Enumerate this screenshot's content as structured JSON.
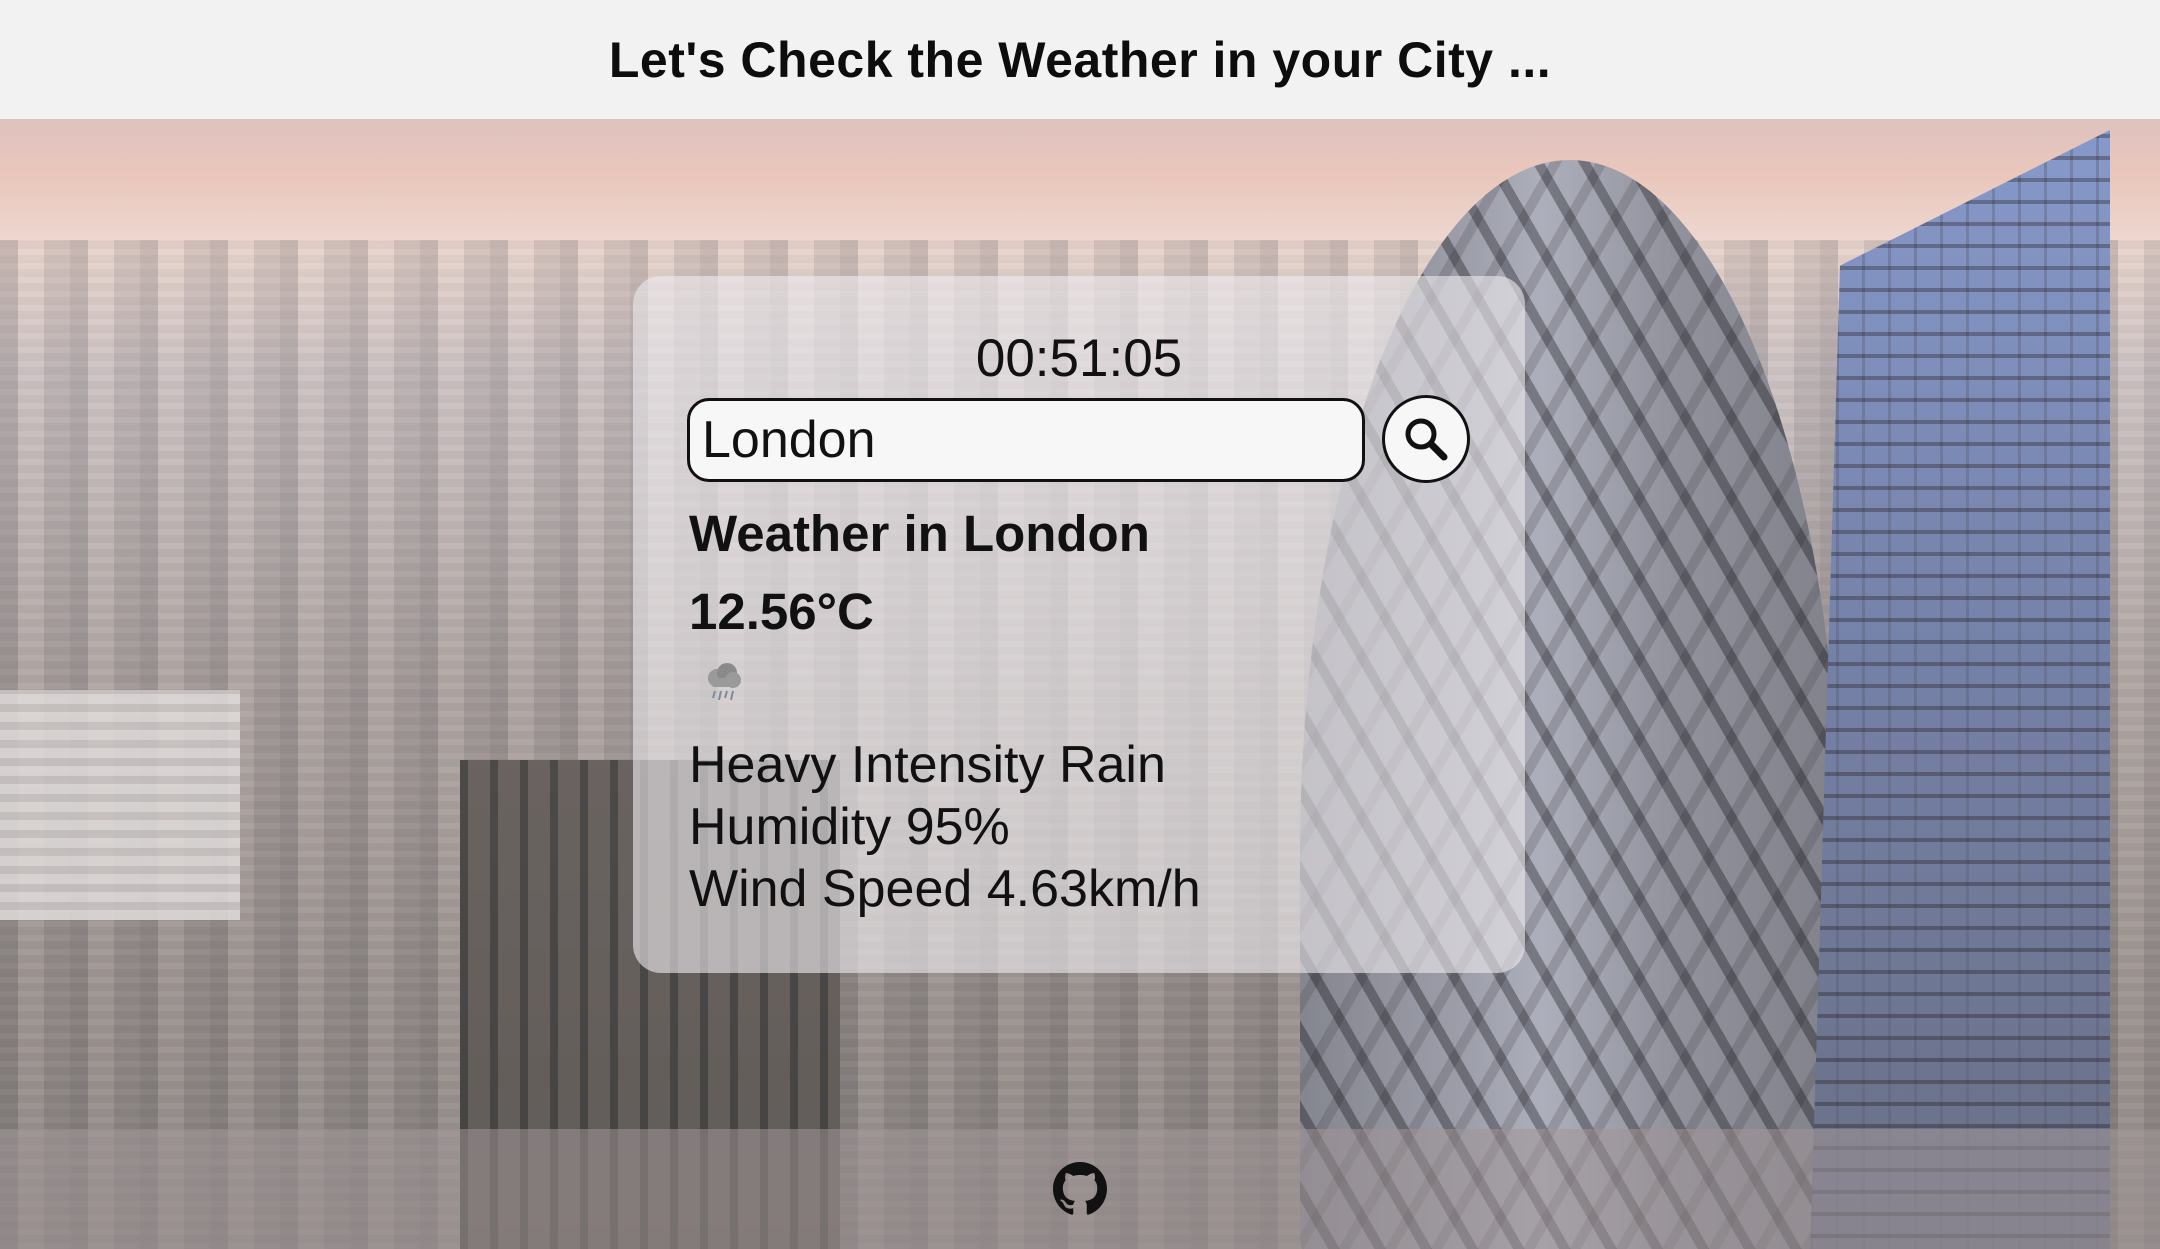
{
  "header": {
    "title": "Let's Check the Weather in your City ..."
  },
  "card": {
    "clock": "00:51:05",
    "search": {
      "value": "London",
      "button_icon": "search-icon"
    },
    "city_heading": "Weather in London",
    "temperature": "12.56°C",
    "weather_icon": "rain-cloud-icon",
    "description": "Heavy Intensity Rain",
    "humidity": "Humidity 95%",
    "wind": "Wind Speed 4.63km/h"
  },
  "footer": {
    "link_icon": "github-icon"
  },
  "colors": {
    "header_bg": "#f2f2f2",
    "text": "#111111",
    "card_bg": "rgba(235,232,236,0.62)"
  }
}
